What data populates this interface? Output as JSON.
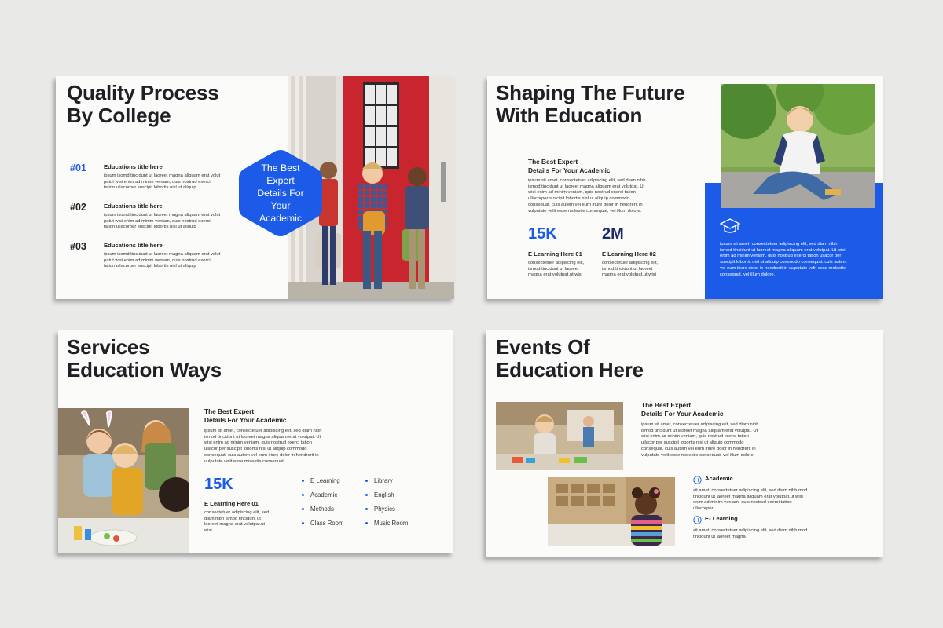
{
  "slides": [
    {
      "title": [
        "Quality Process",
        "By College"
      ],
      "badge": [
        "The Best",
        "Expert",
        "Details For",
        "Your",
        "Academic"
      ],
      "items": [
        {
          "num": "#01",
          "heading": "Educations title here",
          "text": "ipsum isomd tincidunt ut laoreet magna aliquam erat volut patut wisi enim ad minim veniam, quis nostrud exerci tation ullacorper suscipit lobortis nisl ut aliquip"
        },
        {
          "num": "#02",
          "heading": "Educations title here",
          "text": "ipsum isomd tincidunt ut laoreet magna aliquam erat volut patut wisi enim ad minim veniam, quis nostrud exerci tation ullacorper suscipit lobortis nisl ut aliquip"
        },
        {
          "num": "#03",
          "heading": "Educations title here",
          "text": "ipsum isomd tincidunt ut laoreet magna aliquam erat volut patut wisi enim ad minim veniam, quis nostrud exerci tation ullacorper suscipit lobortis nisl ut aliquip"
        }
      ]
    },
    {
      "title": [
        "Shaping The Future",
        "With Education"
      ],
      "subtitle": [
        "The Best Expert",
        "Details For Your Academic"
      ],
      "text": "ipsum sit amet, consectetuer adipiscing elit, sed diam nibh ismod tincidunt ut laoreet magna aliquam erat volutpat. Ut wisi enim ad minim veniam, quis nostrud exerci tation ullacorper suscipit lobortis nisl ut aliquip commodo consequat. cuis autem vel eum iriure dolor in hendrerit in vulputate velit esse molestie consequat, vel illum dolore.",
      "stats": [
        {
          "value": "15K",
          "label": "E Learning Here 01",
          "text": "consectetuer adipiscing elit, ismod tincidunt ut laoreet magna erat volutpat.ut wisi"
        },
        {
          "value": "2M",
          "label": "E Learning Here 02",
          "text": "consectetuer adipiscing elit, ismod tincidunt ut laoreet magna erat volutpat.ut wisi"
        }
      ],
      "panel_text": "ipsum sit amet, consectetuer adipiscing elit, sed diam nibh ismod tincidunt ut laoreet magna aliquam erat volutpat. Ut wisi enim ad minim veniam, quis nostrud exerci tation ullacor per suscipit lobortis nisl ut aliquip commodo consequat. cuis autem vel eum iriure dolor in hendrerit in vulputate velit esse molestie consequat, vel illum dolore.",
      "accent": "#1b5be8"
    },
    {
      "title": [
        "Services",
        "Education Ways"
      ],
      "subtitle": [
        "The Best Expert",
        "Details For Your Academic"
      ],
      "text": "ipsum sit amet, consectetuer adipiscing elit, sed diam nibh ismod tincidunt ut laoreet magna aliquam erat volutpat. Ut wisi enim ad minim veniam, quis nostrud exerci tation ullacor per suscipit lobortis nisl ut aliquip commodo consequat. cuis autem vel eum iriure dolor in hendrerit in vulputate velit esse molestie consequat.",
      "stat": {
        "value": "15K",
        "label": "E Learning Here 01",
        "text": "consectetuer adipiscing elit, sed diam nibh ismod tincidunt ut laoreet magna erat volutpat.ut wisi"
      },
      "list_left": [
        "E Learning",
        "Academic",
        "Methods",
        "Class Room"
      ],
      "list_right": [
        "Library",
        "English",
        "Physics",
        "Music Room"
      ]
    },
    {
      "title": [
        "Events Of",
        "Education Here"
      ],
      "subtitle": [
        "The Best Expert",
        "Details For Your Academic"
      ],
      "text": "ipsum sit amet, consectetuer adipiscing elit, sed diam nibh ismod tincidunt ut laoreet magna aliquam erat volutpat. Ut wisi enim ad minim veniam, quis nostrud exerci tation ullacor per suscipit lobortis nisl ut aliquip commodo consequat. cuis autem vel eum iriure dolor in hendrerit in vulputate velit esse molestie consequat, vel illum dolore.",
      "items": [
        {
          "heading": "Academic",
          "text": "sit amet, consectetuer adipiscing elit, sed diam nibh mod tincidunt ut laoreet magna aliquam erat volutpat.ut wisi enim ad minim veniam, quis nostrud exerci tation ullacorper"
        },
        {
          "heading": "E- Learning",
          "text": "sit amet, consectetuer adipiscing elit, sed diam nibh mod tincidunt ut laoreet magna"
        }
      ]
    }
  ]
}
